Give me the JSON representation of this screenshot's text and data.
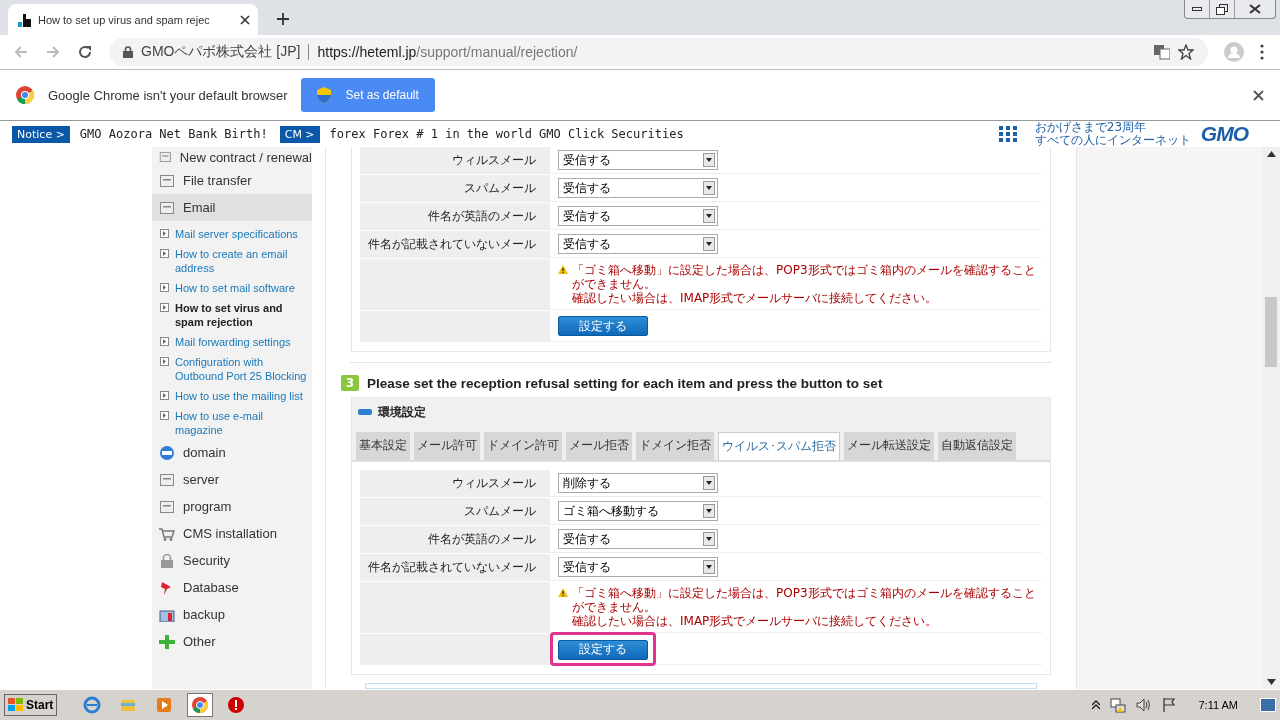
{
  "browser": {
    "tab": {
      "title": "How to set up virus and spam rejec"
    },
    "address": {
      "site_label": "GMOペパボ株式会社 [JP]",
      "host": "https://heteml.jp",
      "path": "/support/manual/rejection/"
    },
    "infobar": {
      "message": "Google Chrome isn't your default browser",
      "button": "Set as default"
    }
  },
  "ticker": [
    {
      "tag": "Notice >",
      "text": "GMO Aozora Net Bank Birth!"
    },
    {
      "tag": "CM >",
      "text": "forex Forex # 1 in the world GMO Click Securities"
    }
  ],
  "brand": {
    "tagline_1": "おかげさまで23周年",
    "tagline_2": "すべての人にインターネット",
    "logo": "GMO"
  },
  "sidebar": {
    "items": [
      {
        "label": "New contract / renewal",
        "selected": false
      },
      {
        "label": "File transfer",
        "selected": false
      },
      {
        "label": "Email",
        "selected": true,
        "children": [
          {
            "label": "Mail server specifications",
            "selected": false
          },
          {
            "label": "How to create an email address",
            "selected": false
          },
          {
            "label": "How to set mail software",
            "selected": false
          },
          {
            "label": "How to set virus and spam rejection",
            "selected": true
          },
          {
            "label": "Mail forwarding settings",
            "selected": false
          },
          {
            "label": "Configuration with Outbound Port 25 Blocking",
            "selected": false
          },
          {
            "label": "How to use the mailing list",
            "selected": false
          },
          {
            "label": "How to use e-mail magazine",
            "selected": false
          }
        ]
      },
      {
        "label": "domain",
        "selected": false
      },
      {
        "label": "server",
        "selected": false
      },
      {
        "label": "program",
        "selected": false
      },
      {
        "label": "CMS installation",
        "selected": false
      },
      {
        "label": "Security",
        "selected": false
      },
      {
        "label": "Database",
        "selected": false
      },
      {
        "label": "backup",
        "selected": false
      },
      {
        "label": "Other",
        "selected": false
      }
    ]
  },
  "sections": [
    {
      "panel": {
        "rows": [
          {
            "label": "ウィルスメール",
            "value": "受信する"
          },
          {
            "label": "スパムメール",
            "value": "受信する"
          },
          {
            "label": "件名が英語のメール",
            "value": "受信する"
          },
          {
            "label": "件名が記載されていないメール",
            "value": "受信する"
          }
        ],
        "note_lines": [
          "「ゴミ箱へ移動」に設定した場合は、POP3形式ではゴミ箱内のメールを確認することができません。",
          "確認したい場合は、IMAP形式でメールサーバに接続してください。"
        ],
        "button": "設定する",
        "highlighted": false
      }
    },
    {
      "step": {
        "number": "3",
        "text": "Please set the reception refusal setting for each item and press the button to set"
      },
      "panel": {
        "title": "環境設定",
        "tabs": [
          {
            "label": "基本設定",
            "selected": false
          },
          {
            "label": "メール許可",
            "selected": false
          },
          {
            "label": "ドメイン許可",
            "selected": false
          },
          {
            "label": "メール拒否",
            "selected": false
          },
          {
            "label": "ドメイン拒否",
            "selected": false
          },
          {
            "label": "ウイルス･スパム拒否",
            "selected": true
          },
          {
            "label": "メール転送設定",
            "selected": false
          },
          {
            "label": "自動返信設定",
            "selected": false
          }
        ],
        "rows": [
          {
            "label": "ウィルスメール",
            "value": "削除する"
          },
          {
            "label": "スパムメール",
            "value": "ゴミ箱へ移動する"
          },
          {
            "label": "件名が英語のメール",
            "value": "受信する"
          },
          {
            "label": "件名が記載されていないメール",
            "value": "受信する"
          }
        ],
        "note_lines": [
          "「ゴミ箱へ移動」に設定した場合は、POP3形式ではゴミ箱内のメールを確認することができません。",
          "確認したい場合は、IMAP形式でメールサーバに接続してください。"
        ],
        "button": "設定する",
        "highlighted": true
      }
    }
  ],
  "taskbar": {
    "start": "Start",
    "apps": [
      {
        "selected": false
      },
      {
        "selected": false
      },
      {
        "selected": false
      },
      {
        "selected": true
      },
      {
        "selected": false
      }
    ],
    "clock": "7:11 AM"
  }
}
